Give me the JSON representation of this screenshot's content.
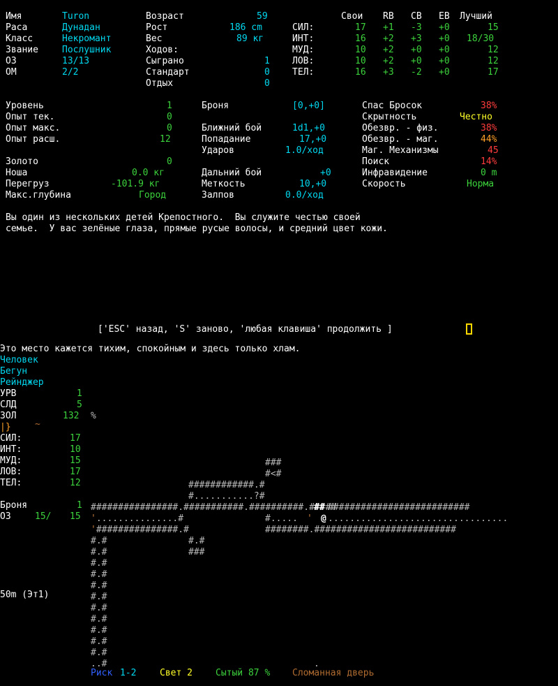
{
  "char": {
    "name_label": "Имя",
    "name": "Turon",
    "race_label": "Раса",
    "race": "Дунадан",
    "class_label": "Класс",
    "class": "Некромант",
    "title_label": "Звание",
    "title": "Послушник",
    "hp_label": "ОЗ",
    "hp": "13/13",
    "sp_label": "ОМ",
    "sp": "2/2",
    "age_label": "Возраст",
    "age": "59",
    "height_label": "Рост",
    "height": "186 cm",
    "weight_label": "Вес",
    "weight": "89 кг",
    "turns_label": "Ходов:",
    "played_label": "Сыграно",
    "played": "1",
    "standard_label": "Стандарт",
    "standard": "0",
    "rest_label": "Отдых",
    "rest": "0"
  },
  "stats": {
    "headers": [
      "Свои",
      "RB",
      "CB",
      "EB",
      "Лучший"
    ],
    "rows": [
      {
        "label": "СИЛ:",
        "own": "17",
        "rb": "+1",
        "cb": "-3",
        "eb": "+0",
        "best": "15"
      },
      {
        "label": "ИНТ:",
        "own": "16",
        "rb": "+2",
        "cb": "+3",
        "eb": "+0",
        "best": "18/30"
      },
      {
        "label": "МУД:",
        "own": "10",
        "rb": "+2",
        "cb": "+0",
        "eb": "+0",
        "best": "12"
      },
      {
        "label": "ЛОВ:",
        "own": "10",
        "rb": "+2",
        "cb": "+0",
        "eb": "+0",
        "best": "12"
      },
      {
        "label": "ТЕЛ:",
        "own": "16",
        "rb": "+3",
        "cb": "-2",
        "eb": "+0",
        "best": "17"
      }
    ]
  },
  "progress": {
    "level_label": "Уровень",
    "level": "1",
    "exp_cur_label": "Опыт тек.",
    "exp_cur": "0",
    "exp_max_label": "Опыт макс.",
    "exp_max": "0",
    "exp_adv_label": "Опыт расш.",
    "exp_adv": "12",
    "gold_label": "Золото",
    "gold": "0",
    "burden_label": "Ноша",
    "burden": "0.0 кг",
    "overweight_label": "Перегруз",
    "overweight": "-101.9 кг",
    "maxdepth_label": "Макс.глубина",
    "maxdepth": "Город"
  },
  "combat": {
    "armor_label": "Броня",
    "armor": "[0,+0]",
    "melee_label": "Ближний бой",
    "melee": "1d1,+0",
    "tohit_label": "Попадание",
    "tohit": "17,+0",
    "blows_label": "Ударов",
    "blows": "1.0/ход",
    "shoot_label": "Дальний бой",
    "shoot": "+0",
    "accuracy_label": "Меткость",
    "accuracy": "10,+0",
    "shots_label": "Залпов",
    "shots": "0.0/ход"
  },
  "skills": {
    "save_label": "Спас Бросок",
    "save": "38%",
    "stealth_label": "Скрытность",
    "stealth": "Честно",
    "disarm_phys_label": "Обезвр. - физ.",
    "disarm_phys": "38%",
    "disarm_mag_label": "Обезвр. - маг.",
    "disarm_mag": "44%",
    "devices_label": "Маг. Механизмы",
    "devices": "45",
    "search_label": "Поиск",
    "search": "14%",
    "infra_label": "Инфравидение",
    "infra": "0 m",
    "speed_label": "Скорость",
    "speed": "Норма"
  },
  "history": {
    "line1": "Вы один из нескольких детей Крепостного.  Вы служите честью своей",
    "line2": "семье.  У вас зелёные глаза, прямые русые волосы, и средний цвет кожи."
  },
  "prompt": "['ESC' назад, 'S' заново, 'любая клавиша' продолжить ]",
  "message": "Это место кажется тихим, спокойным и здесь только хлам.",
  "sidebar": {
    "race": "Человек",
    "class": "Бегун",
    "title": "Рейнджер",
    "lvl_label": "УРВ",
    "lvl": "1",
    "next_label": "СЛД",
    "next": "5",
    "gold_label": "ЗОЛ",
    "gold": "132",
    "gold_extra": "%",
    "equip": "|}",
    "equip2": "~",
    "str_label": "СИЛ:",
    "str": "17",
    "int_label": "ИНТ:",
    "int": "10",
    "wis_label": "МУД:",
    "wis": "15",
    "dex_label": "ЛОВ:",
    "dex": "17",
    "con_label": "ТЕЛ:",
    "con": "12",
    "armor_label": "Броня",
    "armor": "1",
    "hp_label": "ОЗ",
    "hp": "15/",
    "hp_max": "15",
    "depth": "50m (Эт1)"
  },
  "statusbar": {
    "risk_label": "Риск",
    "risk": "1-2",
    "light": "Свет 2",
    "fed": "Сытый 87 %",
    "door": "Сломанная дверь"
  },
  "colors": {
    "cyan": "#00d8f0",
    "green": "#3cd23c",
    "yellow": "#ffff28",
    "red": "#ff3c3c",
    "orange": "#ffa028",
    "blue": "#3060ff",
    "brown": "#b06c30"
  }
}
